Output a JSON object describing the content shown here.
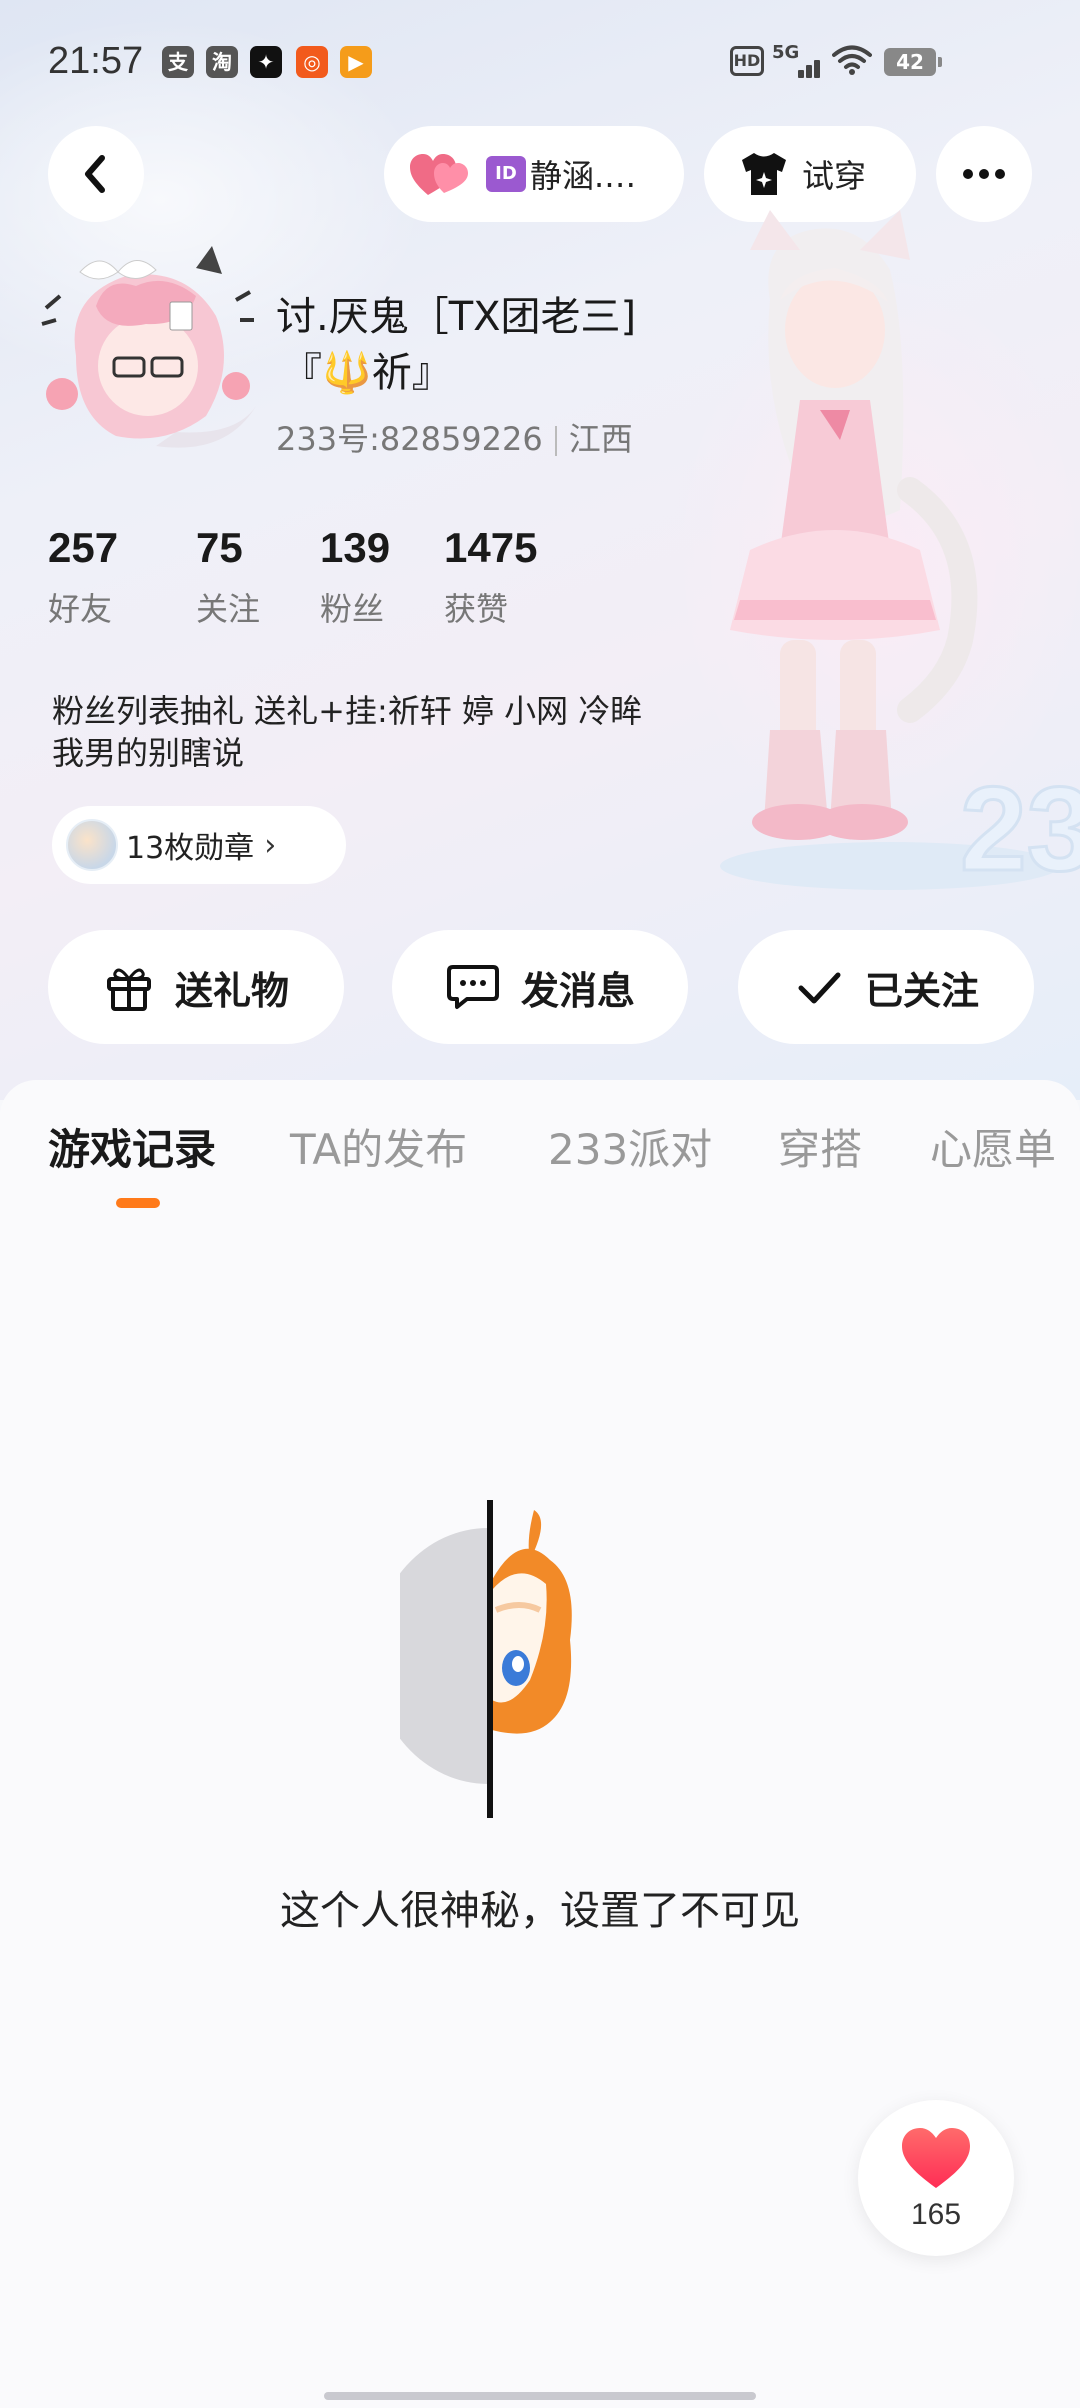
{
  "status_bar": {
    "time": "21:57",
    "notification_icons": [
      "alipay-icon",
      "taobao-icon",
      "app-icon",
      "orange-app-icon",
      "video-app-icon"
    ],
    "hd_label": "HD",
    "network_label": "5G",
    "battery_level": "42"
  },
  "top_nav": {
    "relation_label": "静涵.…",
    "tryon_label": "试穿"
  },
  "profile": {
    "nickname_line1": "讨.厌鬼［TX团老三]",
    "nickname_line2": "『🔱祈』",
    "user_id": "233号:82859226",
    "region": "江西",
    "stats": [
      {
        "value": "257",
        "label": "好友"
      },
      {
        "value": "75",
        "label": "关注"
      },
      {
        "value": "139",
        "label": "粉丝"
      },
      {
        "value": "1475",
        "label": "获赞"
      }
    ],
    "bio_line1": "粉丝列表抽礼 送礼+挂:祈轩 婷 小网 冷眸",
    "bio_line2": "我男的别瞎说",
    "badges_label": "13枚勋章"
  },
  "actions": {
    "gift_label": "送礼物",
    "message_label": "发消息",
    "follow_label": "已关注"
  },
  "tabs": [
    {
      "label": "游戏记录",
      "active": true
    },
    {
      "label": "TA的发布",
      "active": false
    },
    {
      "label": "233派对",
      "active": false
    },
    {
      "label": "穿搭",
      "active": false
    },
    {
      "label": "心愿单",
      "active": false
    }
  ],
  "empty_state": {
    "message": "这个人很神秘，设置了不可见"
  },
  "like": {
    "count": "165"
  },
  "colors": {
    "accent": "#ff7a1a",
    "heart": "#ff4d6a",
    "primary_text": "#1a1a1a",
    "secondary_text": "#999999"
  }
}
